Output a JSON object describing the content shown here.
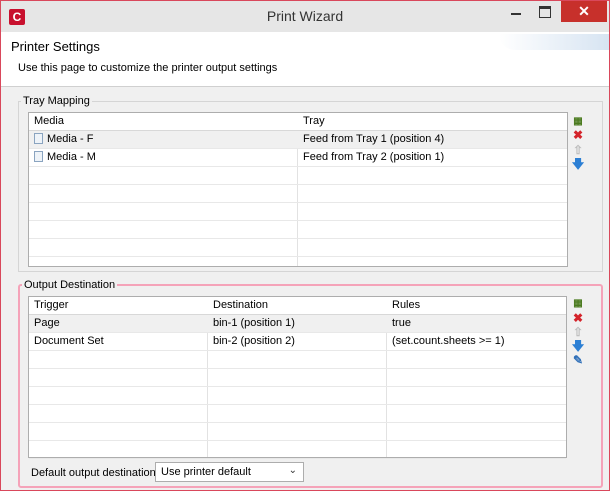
{
  "window": {
    "title": "Print Wizard",
    "app_icon": "C",
    "close_glyph": "✕"
  },
  "header": {
    "title": "Printer Settings",
    "description": "Use this page to customize the printer output settings"
  },
  "tray_mapping": {
    "legend": "Tray Mapping",
    "columns": [
      "Media",
      "Tray"
    ],
    "rows": [
      {
        "media": "Media - F",
        "tray": "Feed from Tray 1 (position 4)"
      },
      {
        "media": "Media - M",
        "tray": "Feed from Tray 2 (position 1)"
      }
    ],
    "icons": [
      "add-icon",
      "delete-icon",
      "move-up-icon",
      "move-down-icon"
    ]
  },
  "output_destination": {
    "legend": "Output Destination",
    "columns": [
      "Trigger",
      "Destination",
      "Rules"
    ],
    "rows": [
      {
        "trigger": "Page",
        "destination": "bin-1 (position 1)",
        "rules": "true"
      },
      {
        "trigger": "Document Set",
        "destination": "bin-2 (position 2)",
        "rules": "(set.count.sheets >= 1)"
      }
    ],
    "icons": [
      "add-icon",
      "delete-icon",
      "move-up-icon",
      "move-down-icon",
      "edit-icon"
    ],
    "default_label": "Default output destination:",
    "default_value": "Use printer default"
  },
  "colors": {
    "close_button": "#c7302b",
    "highlight_border": "#f5a3b9",
    "app_icon": "#c8102e"
  }
}
